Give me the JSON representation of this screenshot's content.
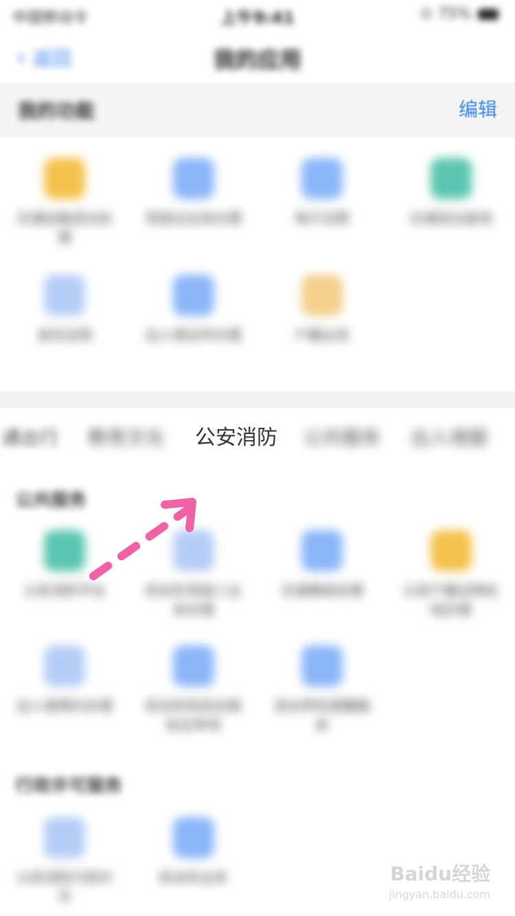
{
  "status_bar": {
    "time": "中国移动令",
    "center": "上午9:41",
    "right": "⊙ 75%"
  },
  "nav": {
    "back_label": "返回",
    "title": "我的应用"
  },
  "my_apps": {
    "title": "我的功能",
    "edit_label": "编辑",
    "items": [
      {
        "label": "交通运输违法处理",
        "color": "#f4c24c"
      },
      {
        "label": "驾驶证业务办理",
        "color": "#8bb6f8"
      },
      {
        "label": "电子证照",
        "color": "#8bb6f8"
      },
      {
        "label": "交通违法查询",
        "color": "#5bc6b0"
      },
      {
        "label": "身份证明",
        "color": "#b5cdf6"
      },
      {
        "label": "出入境证件办理",
        "color": "#8bb6f8"
      },
      {
        "label": "户籍业务",
        "color": "#f3cf8b"
      }
    ]
  },
  "tabs": [
    {
      "label": "通出行",
      "active": false
    },
    {
      "label": "教育文化",
      "active": false
    },
    {
      "label": "公安消防",
      "active": true
    },
    {
      "label": "公共服务",
      "active": false
    },
    {
      "label": "出入境服",
      "active": false
    }
  ],
  "section1": {
    "title": "公共服务",
    "items": [
      {
        "label": "公安消防平台",
        "color": "#5bc6b0"
      },
      {
        "label": "机动车驾驶人业务办理",
        "color": "#b5cdf6"
      },
      {
        "label": "交通事故处理",
        "color": "#8bb6f8"
      },
      {
        "label": "公安户籍证明在线办理",
        "color": "#f4c24c"
      },
      {
        "label": "出入境预约办理",
        "color": "#b5cdf6"
      },
      {
        "label": "机动车检验合格标志申领",
        "color": "#8bb6f8"
      },
      {
        "label": "违法停车提醒服务",
        "color": "#8bb6f8"
      }
    ]
  },
  "section2": {
    "title": "行政许可服务",
    "items": [
      {
        "label": "公安消防行政许可",
        "color": "#b5cdf6"
      },
      {
        "label": "机动车业务",
        "color": "#8bb6f8"
      }
    ]
  },
  "watermark": {
    "logo": "Baidu经验",
    "url": "jingyan.baidu.com"
  }
}
